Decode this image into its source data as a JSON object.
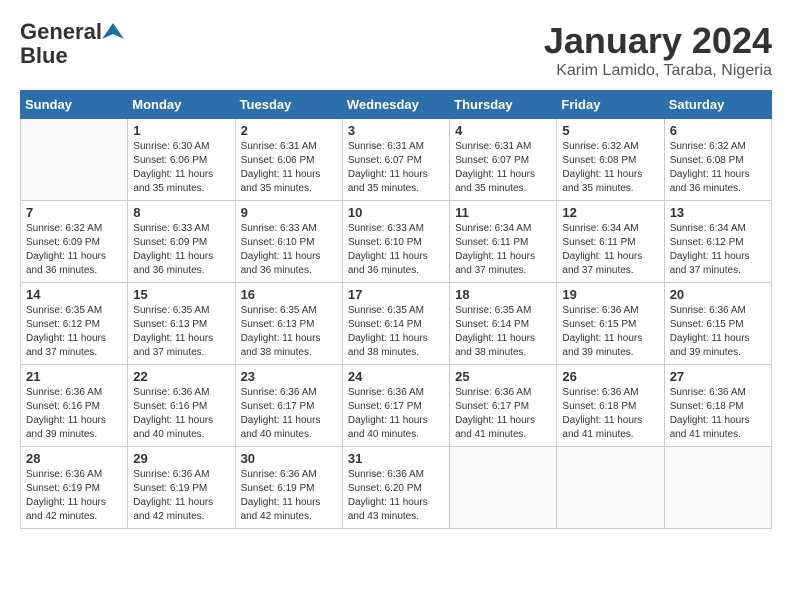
{
  "header": {
    "logo_line1": "General",
    "logo_line2": "Blue",
    "month": "January 2024",
    "location": "Karim Lamido, Taraba, Nigeria"
  },
  "days_of_week": [
    "Sunday",
    "Monday",
    "Tuesday",
    "Wednesday",
    "Thursday",
    "Friday",
    "Saturday"
  ],
  "weeks": [
    [
      {
        "day": "",
        "info": ""
      },
      {
        "day": "1",
        "info": "Sunrise: 6:30 AM\nSunset: 6:06 PM\nDaylight: 11 hours\nand 35 minutes."
      },
      {
        "day": "2",
        "info": "Sunrise: 6:31 AM\nSunset: 6:06 PM\nDaylight: 11 hours\nand 35 minutes."
      },
      {
        "day": "3",
        "info": "Sunrise: 6:31 AM\nSunset: 6:07 PM\nDaylight: 11 hours\nand 35 minutes."
      },
      {
        "day": "4",
        "info": "Sunrise: 6:31 AM\nSunset: 6:07 PM\nDaylight: 11 hours\nand 35 minutes."
      },
      {
        "day": "5",
        "info": "Sunrise: 6:32 AM\nSunset: 6:08 PM\nDaylight: 11 hours\nand 35 minutes."
      },
      {
        "day": "6",
        "info": "Sunrise: 6:32 AM\nSunset: 6:08 PM\nDaylight: 11 hours\nand 36 minutes."
      }
    ],
    [
      {
        "day": "7",
        "info": "Sunrise: 6:32 AM\nSunset: 6:09 PM\nDaylight: 11 hours\nand 36 minutes."
      },
      {
        "day": "8",
        "info": "Sunrise: 6:33 AM\nSunset: 6:09 PM\nDaylight: 11 hours\nand 36 minutes."
      },
      {
        "day": "9",
        "info": "Sunrise: 6:33 AM\nSunset: 6:10 PM\nDaylight: 11 hours\nand 36 minutes."
      },
      {
        "day": "10",
        "info": "Sunrise: 6:33 AM\nSunset: 6:10 PM\nDaylight: 11 hours\nand 36 minutes."
      },
      {
        "day": "11",
        "info": "Sunrise: 6:34 AM\nSunset: 6:11 PM\nDaylight: 11 hours\nand 37 minutes."
      },
      {
        "day": "12",
        "info": "Sunrise: 6:34 AM\nSunset: 6:11 PM\nDaylight: 11 hours\nand 37 minutes."
      },
      {
        "day": "13",
        "info": "Sunrise: 6:34 AM\nSunset: 6:12 PM\nDaylight: 11 hours\nand 37 minutes."
      }
    ],
    [
      {
        "day": "14",
        "info": "Sunrise: 6:35 AM\nSunset: 6:12 PM\nDaylight: 11 hours\nand 37 minutes."
      },
      {
        "day": "15",
        "info": "Sunrise: 6:35 AM\nSunset: 6:13 PM\nDaylight: 11 hours\nand 37 minutes."
      },
      {
        "day": "16",
        "info": "Sunrise: 6:35 AM\nSunset: 6:13 PM\nDaylight: 11 hours\nand 38 minutes."
      },
      {
        "day": "17",
        "info": "Sunrise: 6:35 AM\nSunset: 6:14 PM\nDaylight: 11 hours\nand 38 minutes."
      },
      {
        "day": "18",
        "info": "Sunrise: 6:35 AM\nSunset: 6:14 PM\nDaylight: 11 hours\nand 38 minutes."
      },
      {
        "day": "19",
        "info": "Sunrise: 6:36 AM\nSunset: 6:15 PM\nDaylight: 11 hours\nand 39 minutes."
      },
      {
        "day": "20",
        "info": "Sunrise: 6:36 AM\nSunset: 6:15 PM\nDaylight: 11 hours\nand 39 minutes."
      }
    ],
    [
      {
        "day": "21",
        "info": "Sunrise: 6:36 AM\nSunset: 6:16 PM\nDaylight: 11 hours\nand 39 minutes."
      },
      {
        "day": "22",
        "info": "Sunrise: 6:36 AM\nSunset: 6:16 PM\nDaylight: 11 hours\nand 40 minutes."
      },
      {
        "day": "23",
        "info": "Sunrise: 6:36 AM\nSunset: 6:17 PM\nDaylight: 11 hours\nand 40 minutes."
      },
      {
        "day": "24",
        "info": "Sunrise: 6:36 AM\nSunset: 6:17 PM\nDaylight: 11 hours\nand 40 minutes."
      },
      {
        "day": "25",
        "info": "Sunrise: 6:36 AM\nSunset: 6:17 PM\nDaylight: 11 hours\nand 41 minutes."
      },
      {
        "day": "26",
        "info": "Sunrise: 6:36 AM\nSunset: 6:18 PM\nDaylight: 11 hours\nand 41 minutes."
      },
      {
        "day": "27",
        "info": "Sunrise: 6:36 AM\nSunset: 6:18 PM\nDaylight: 11 hours\nand 41 minutes."
      }
    ],
    [
      {
        "day": "28",
        "info": "Sunrise: 6:36 AM\nSunset: 6:19 PM\nDaylight: 11 hours\nand 42 minutes."
      },
      {
        "day": "29",
        "info": "Sunrise: 6:36 AM\nSunset: 6:19 PM\nDaylight: 11 hours\nand 42 minutes."
      },
      {
        "day": "30",
        "info": "Sunrise: 6:36 AM\nSunset: 6:19 PM\nDaylight: 11 hours\nand 42 minutes."
      },
      {
        "day": "31",
        "info": "Sunrise: 6:36 AM\nSunset: 6:20 PM\nDaylight: 11 hours\nand 43 minutes."
      },
      {
        "day": "",
        "info": ""
      },
      {
        "day": "",
        "info": ""
      },
      {
        "day": "",
        "info": ""
      }
    ]
  ]
}
